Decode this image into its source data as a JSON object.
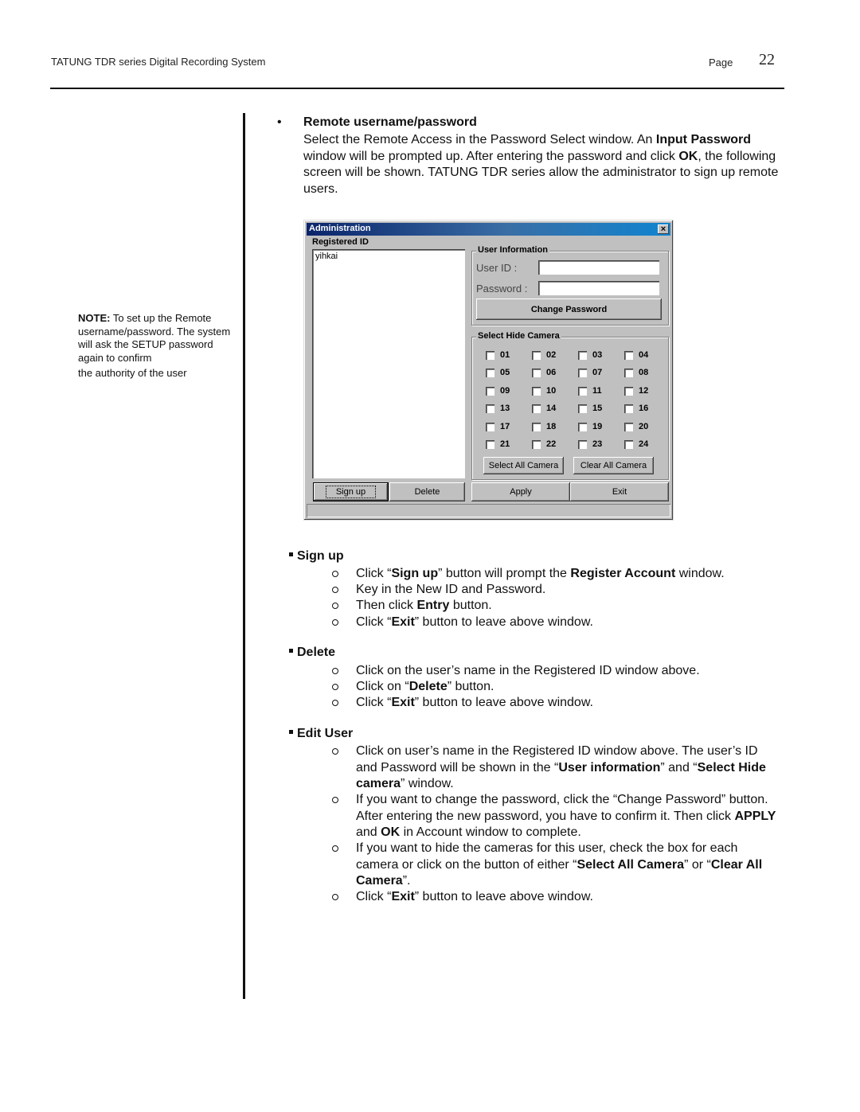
{
  "header": {
    "title": "TATUNG TDR series Digital Recording System",
    "page_label": "Page",
    "page_number": "22"
  },
  "side_note": {
    "label": "NOTE:",
    "text": " To set up the Remote username/password. The system will ask the SETUP password again to confirm",
    "last_line": "the authority of the user"
  },
  "intro": {
    "bullet": "•",
    "title": "Remote username/password",
    "body": [
      {
        "t": "Select the Remote Access in the Password Select window. An ",
        "b": false
      },
      {
        "t": "Input Password",
        "b": true
      },
      {
        "t": " window will be prompted up. After entering the password and click ",
        "b": false
      },
      {
        "t": "OK",
        "b": true
      },
      {
        "t": ", the following screen will be shown. TATUNG TDR series allow the administrator to sign up remote users.",
        "b": false
      }
    ]
  },
  "window": {
    "title": "Administration",
    "close_glyph": "×",
    "registered_id_label": "Registered ID",
    "registered_ids": [
      "yihkai"
    ],
    "user_info_label": "User Information",
    "user_id_label": "User ID   :",
    "user_id_value": "",
    "password_label": "Password :",
    "password_value": "",
    "change_password_button": "Change   Password",
    "hide_camera_label": "Select Hide Camera",
    "cameras": [
      {
        "id": "01",
        "checked": false
      },
      {
        "id": "02",
        "checked": false
      },
      {
        "id": "03",
        "checked": false
      },
      {
        "id": "04",
        "checked": false
      },
      {
        "id": "05",
        "checked": false
      },
      {
        "id": "06",
        "checked": false
      },
      {
        "id": "07",
        "checked": false
      },
      {
        "id": "08",
        "checked": false
      },
      {
        "id": "09",
        "checked": false
      },
      {
        "id": "10",
        "checked": false
      },
      {
        "id": "11",
        "checked": false
      },
      {
        "id": "12",
        "checked": false
      },
      {
        "id": "13",
        "checked": false
      },
      {
        "id": "14",
        "checked": false
      },
      {
        "id": "15",
        "checked": false
      },
      {
        "id": "16",
        "checked": false
      },
      {
        "id": "17",
        "checked": false
      },
      {
        "id": "18",
        "checked": false
      },
      {
        "id": "19",
        "checked": false
      },
      {
        "id": "20",
        "checked": false
      },
      {
        "id": "21",
        "checked": false
      },
      {
        "id": "22",
        "checked": false
      },
      {
        "id": "23",
        "checked": false
      },
      {
        "id": "24",
        "checked": false
      }
    ],
    "select_all_button": "Select All Camera",
    "clear_all_button": "Clear All Camera",
    "signup_button": "Sign up",
    "delete_button": "Delete",
    "apply_button": "Apply",
    "exit_button": "Exit"
  },
  "sections": [
    {
      "title": "Sign up",
      "items": [
        [
          {
            "t": "Click “",
            "b": false
          },
          {
            "t": "Sign up",
            "b": true
          },
          {
            "t": "” button will prompt the ",
            "b": false
          },
          {
            "t": "Register Account",
            "b": true
          },
          {
            "t": " window.",
            "b": false
          }
        ],
        [
          {
            "t": "Key in the New ID and Password.",
            "b": false
          }
        ],
        [
          {
            "t": "Then click ",
            "b": false
          },
          {
            "t": "Entry",
            "b": true
          },
          {
            "t": " button.",
            "b": false
          }
        ],
        [
          {
            "t": "Click “",
            "b": false
          },
          {
            "t": "Exit",
            "b": true
          },
          {
            "t": "” button to leave above window.",
            "b": false
          }
        ]
      ]
    },
    {
      "title": "Delete",
      "items": [
        [
          {
            "t": "Click on the user’s name in the Registered ID window above.",
            "b": false
          }
        ],
        [
          {
            "t": "Click on “",
            "b": false
          },
          {
            "t": "Delete",
            "b": true
          },
          {
            "t": "” button.",
            "b": false
          }
        ],
        [
          {
            "t": "Click “",
            "b": false
          },
          {
            "t": "Exit",
            "b": true
          },
          {
            "t": "” button to leave above window.",
            "b": false
          }
        ]
      ]
    },
    {
      "title": "Edit User",
      "items": [
        [
          {
            "t": "Click on user’s name in the Registered ID window above. The user’s ID and Password will be shown in the “",
            "b": false
          },
          {
            "t": "User information",
            "b": true
          },
          {
            "t": "” and “",
            "b": false
          },
          {
            "t": "Select Hide camera",
            "b": true
          },
          {
            "t": "” window.",
            "b": false
          }
        ],
        [
          {
            "t": "If you want to change the password, click the “Change Password” button. After entering the new password, you have to confirm it. Then click ",
            "b": false
          },
          {
            "t": "APPLY",
            "b": true
          },
          {
            "t": " and ",
            "b": false
          },
          {
            "t": "OK",
            "b": true
          },
          {
            "t": " in Account window to complete.",
            "b": false
          }
        ],
        [
          {
            "t": "If you want to hide the cameras for this user, check the box for each camera or click on the button of either “",
            "b": false
          },
          {
            "t": "Select All Camera",
            "b": true
          },
          {
            "t": "” or “",
            "b": false
          },
          {
            "t": "Clear All Camera",
            "b": true
          },
          {
            "t": "”.",
            "b": false
          }
        ],
        [
          {
            "t": "Click “",
            "b": false
          },
          {
            "t": "Exit",
            "b": true
          },
          {
            "t": "” button to leave above window.",
            "b": false
          }
        ]
      ]
    }
  ]
}
